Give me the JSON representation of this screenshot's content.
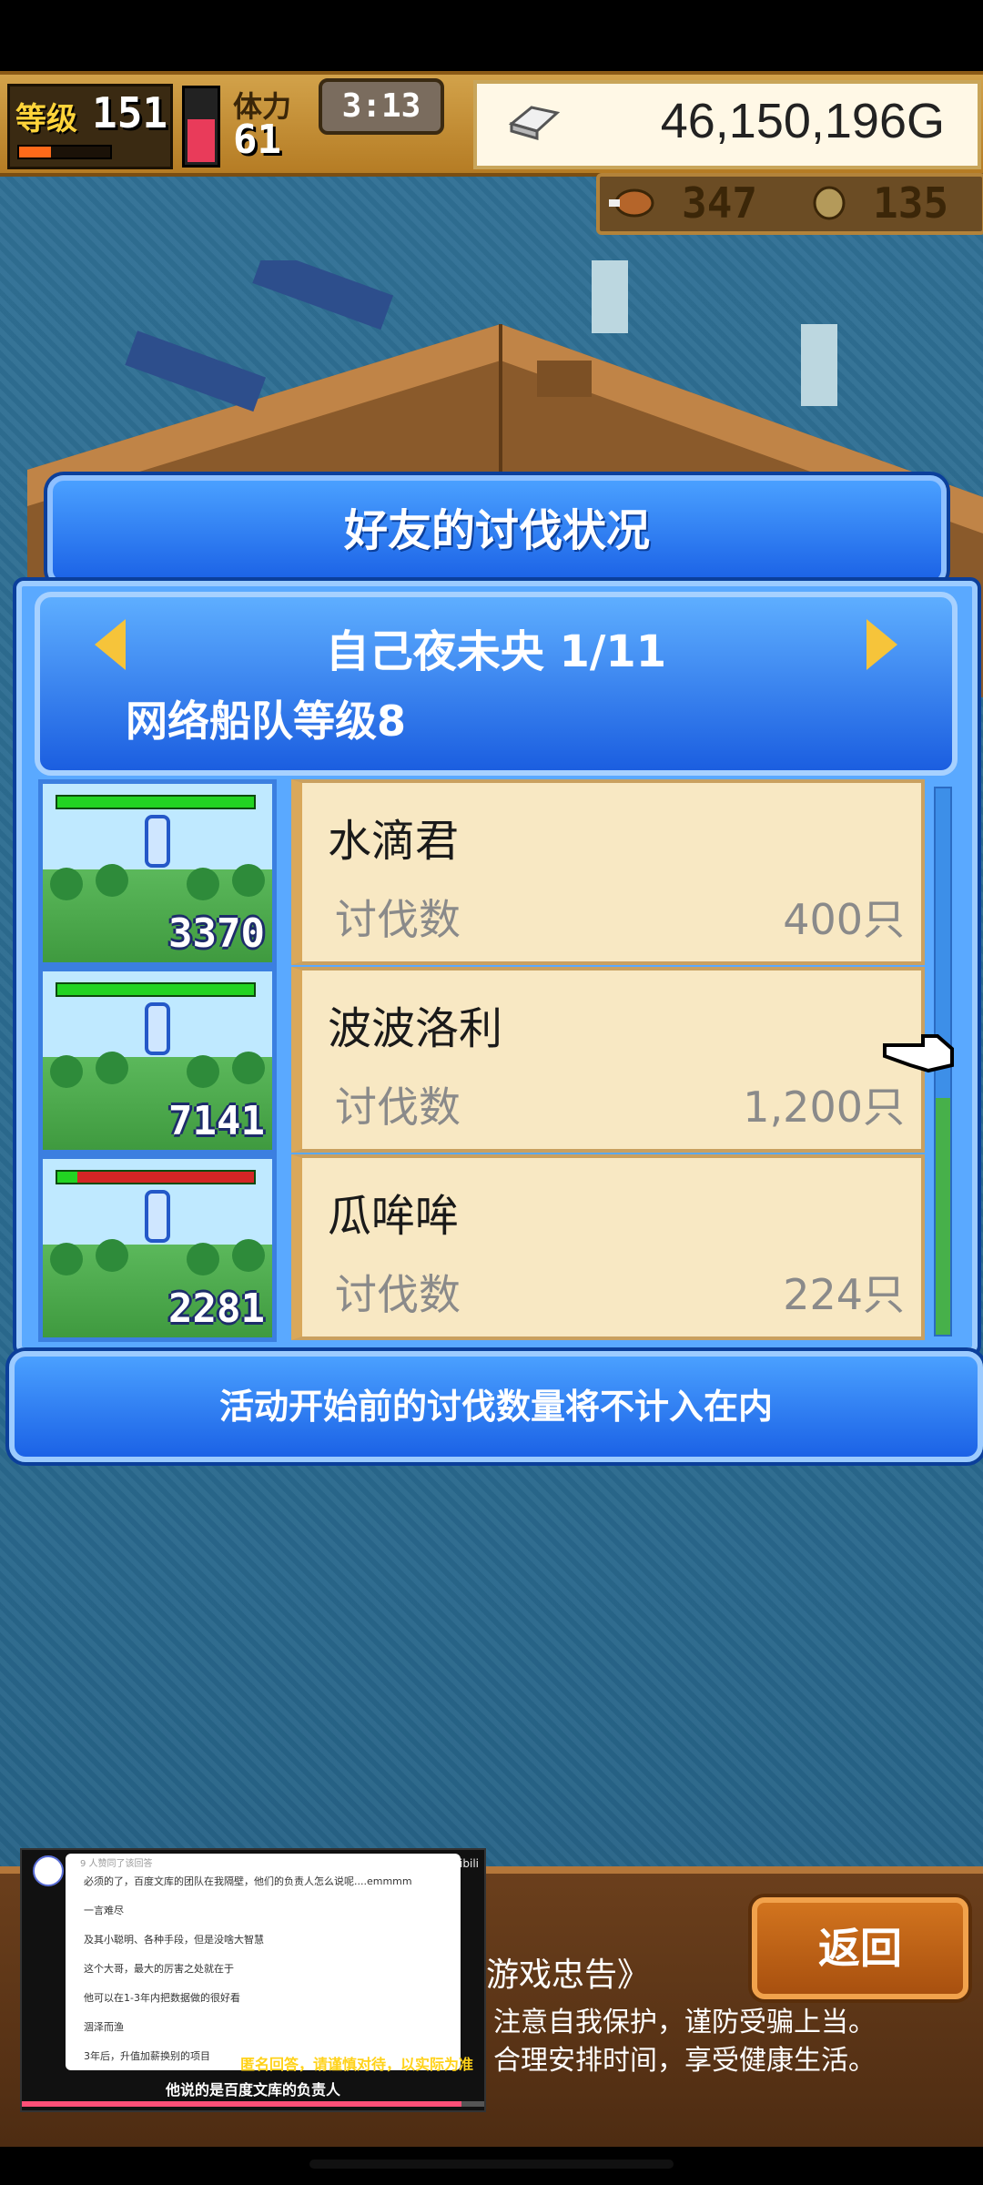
{
  "hud": {
    "level_label": "等级",
    "level_value": "151",
    "exp_progress": 0.35,
    "stamina_label": "体力",
    "stamina_value": "61",
    "stamina_level": 0.6,
    "timer": "3:13",
    "gold": "46,150,196G",
    "resource_1": "347",
    "resource_2": "135"
  },
  "dialog": {
    "title": "好友的讨伐状况",
    "friend_name": "自己夜未央 1/11",
    "fleet_level": "网络船队等级8",
    "rows": [
      {
        "name": "水滴君",
        "kill_label": "讨伐数",
        "kill_value": "400只",
        "count": "3370",
        "hp": 1.0
      },
      {
        "name": "波波洛利",
        "kill_label": "讨伐数",
        "kill_value": "1,200只",
        "count": "7141",
        "hp": 1.0
      },
      {
        "name": "瓜哞哞",
        "kill_label": "讨伐数",
        "kill_value": "224只",
        "count": "2281",
        "hp": 0.1
      }
    ],
    "notice": "活动开始前的讨伐数量将不计入在内"
  },
  "bottom": {
    "return_label": "返回",
    "advice_title": "游戏忠告》",
    "advice_line1": "注意自我保护，谨防受骗上当。",
    "advice_line2": "合理安排时间，享受健康生活。"
  },
  "overlay": {
    "header": "9 人赞同了该回答",
    "brand": "bilibili",
    "lines": [
      "必须的了，百度文库的团队在我隔壁，他们的负责人怎么说呢....emmmm",
      "一言难尽",
      "及其小聪明、各种手段，但是没啥大智慧",
      "这个大哥，最大的厉害之处就在于",
      "他可以在1-3年内把数据做的很好看",
      "涸泽而渔",
      "3年后，升值加薪换别的项目"
    ],
    "warning": "匿名回答，请谨慎对待，以实际为准",
    "caption": "他说的是百度文库的负责人",
    "progress": 0.95
  },
  "colors": {
    "panel_blue": "#1b62e6",
    "card_bg": "#f8e8c3",
    "gold_text": "#ffd43a"
  }
}
